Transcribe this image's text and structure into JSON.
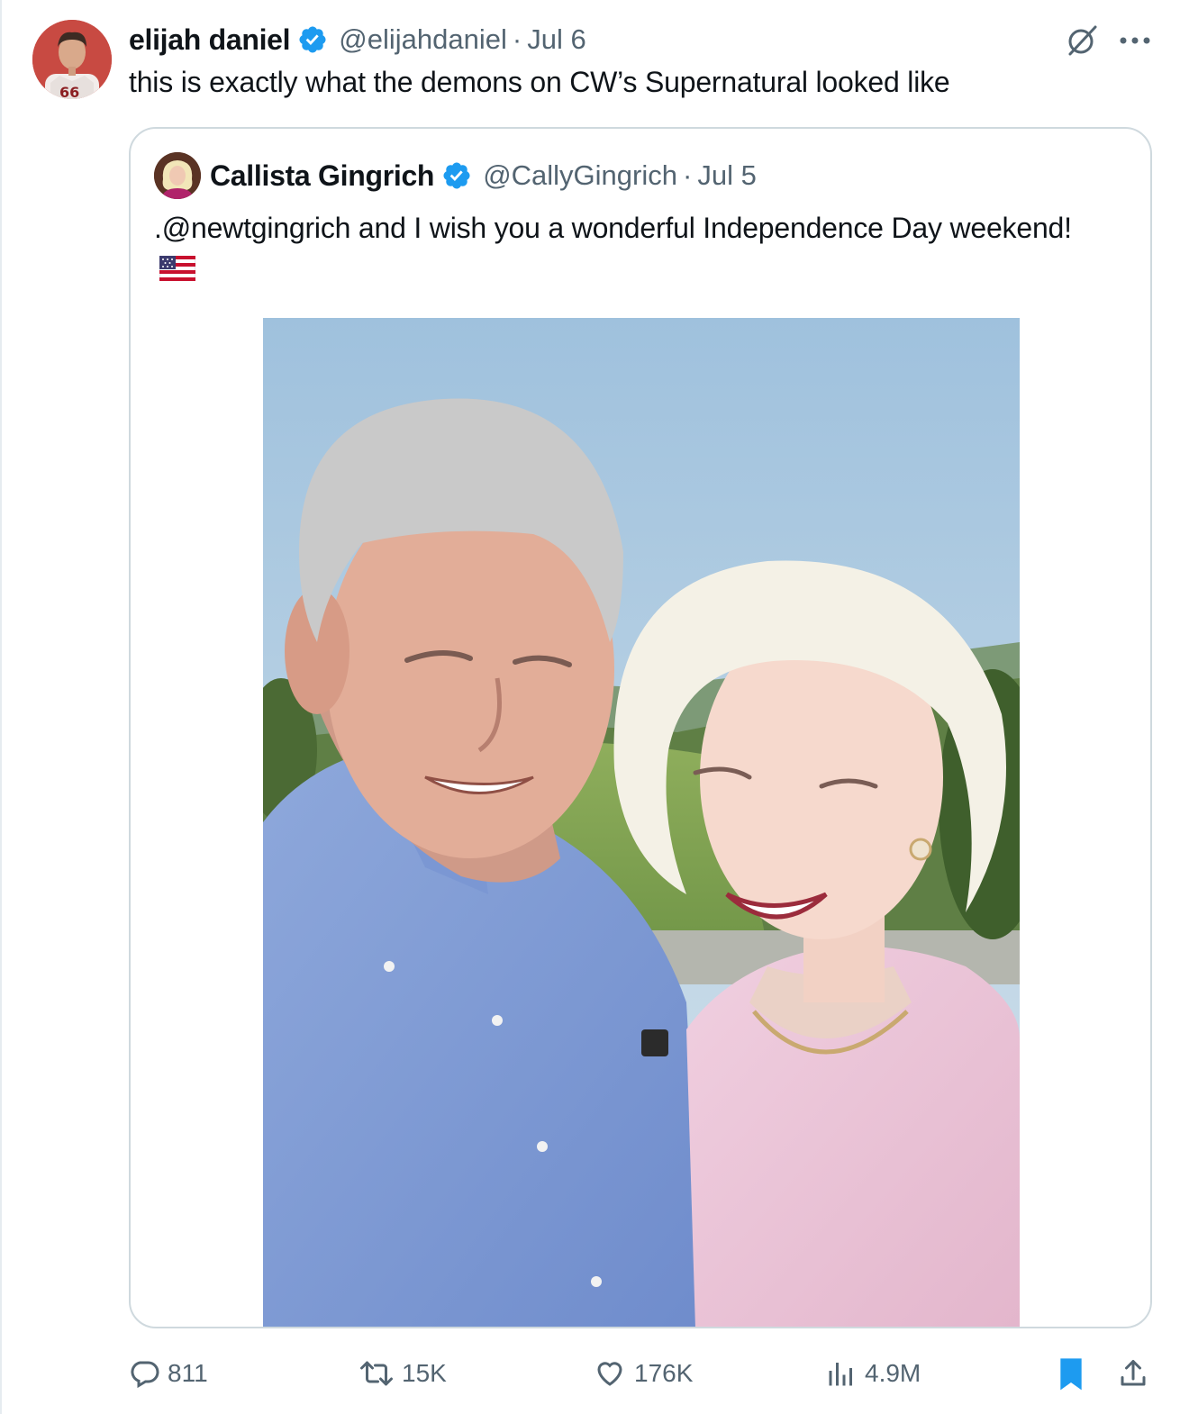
{
  "tweet": {
    "author": {
      "display_name": "elijah daniel",
      "handle": "@elijahdaniel",
      "verified": true,
      "avatar": "avatar-elijah"
    },
    "separator": "·",
    "date": "Jul 6",
    "text": "this is exactly what the demons on CW’s Supernatural looked like",
    "icons": {
      "grok": "grok-icon",
      "more": "more-icon"
    }
  },
  "quoted_tweet": {
    "author": {
      "display_name": "Callista Gingrich",
      "handle": "@CallyGingrich",
      "verified": true,
      "avatar": "avatar-callista"
    },
    "separator": "·",
    "date": "Jul 5",
    "text": ".@newtgingrich and I wish you a wonderful Independence Day weekend!",
    "emoji": "us-flag-emoji",
    "photo": "selfie-photo"
  },
  "actions": {
    "reply_count": "811",
    "retweet_count": "15K",
    "like_count": "176K",
    "view_count": "4.9M",
    "bookmarked": true
  },
  "colors": {
    "text_primary": "#0f1419",
    "text_secondary": "#536471",
    "verified_blue": "#1d9bf0",
    "border": "#cfd9de"
  }
}
